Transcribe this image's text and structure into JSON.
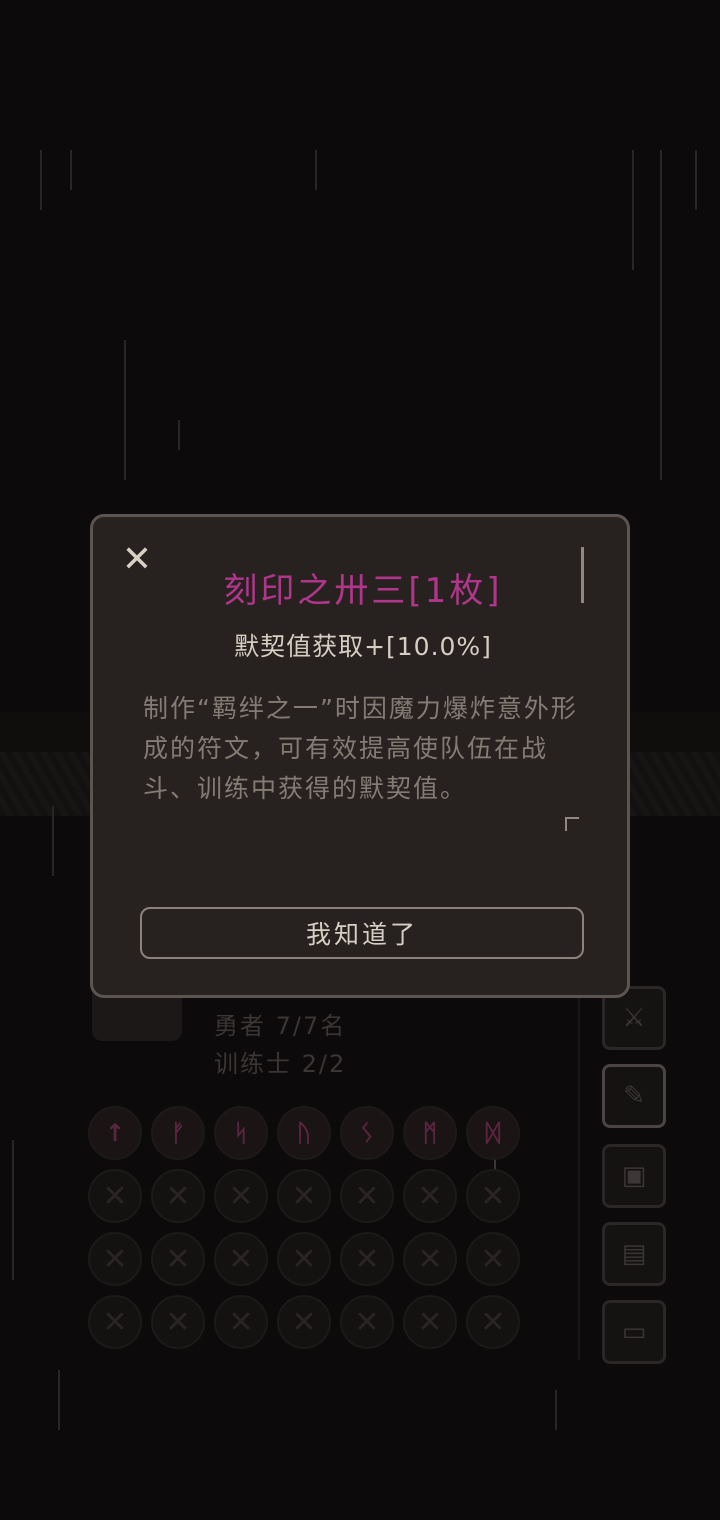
{
  "dialog": {
    "title": "刻印之卅三[1枚]",
    "subtitle": "默契值获取+[10.0%]",
    "description": "制作“羁绊之一”时因魔力爆炸意外形成的符文，可有效提高使队伍在战斗、训练中获得的默契值。",
    "confirm_label": "我知道了",
    "close_glyph": "✕"
  },
  "background": {
    "hero_count": "勇者 7/7名",
    "trainer_count": "训练士 2/2"
  },
  "runes": [
    "↑",
    "ᚠ",
    "ᛋ",
    "ᚢ",
    "ᛊ",
    "ᛗ",
    "ᛞ"
  ],
  "colors": {
    "title": "#b0368b",
    "panel": "#27221f",
    "border": "#5b5450"
  },
  "icons": [
    "sword-icon",
    "scroll-icon",
    "map-icon",
    "document-icon",
    "computer-icon"
  ]
}
